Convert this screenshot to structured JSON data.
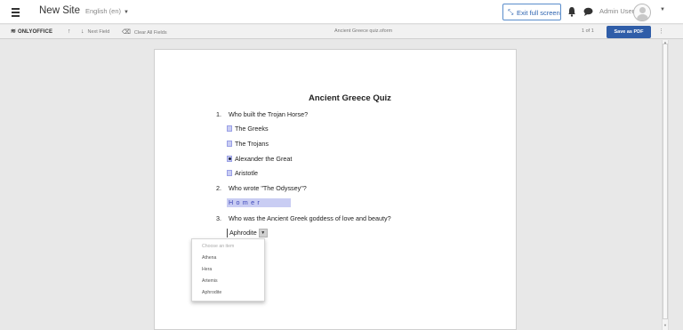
{
  "topbar": {
    "site_name": "New Site",
    "language": "English (en)",
    "exit_fullscreen_label": "Exit full screen",
    "user_name": "Admin User"
  },
  "toolbar": {
    "logo_text": "ONLYOFFICE",
    "next_field_label": "Next Field",
    "clear_fields_label": "Clear All Fields",
    "document_name": "Ancient Greece quiz.oform",
    "page_count": "1 of 1",
    "save_pdf_label": "Save as PDF"
  },
  "document": {
    "title": "Ancient Greece Quiz",
    "questions": [
      {
        "number": "1.",
        "text": "Who built the Trojan Horse?",
        "options": [
          {
            "label": "The Greeks",
            "checked": false
          },
          {
            "label": "The Trojans",
            "checked": false
          },
          {
            "label": "Alexander the Great",
            "checked": true
          },
          {
            "label": "Aristotle",
            "checked": false
          }
        ]
      },
      {
        "number": "2.",
        "text": "Who wrote \"The Odyssey\"?",
        "answer": "Homer"
      },
      {
        "number": "3.",
        "text": "Who was the Ancient Greek goddess of love and beauty?",
        "selected": "Aphrodite",
        "dropdown": {
          "placeholder": "Choose an item",
          "items": [
            "Athena",
            "Hera",
            "Artemis",
            "Aphrodite"
          ]
        }
      }
    ]
  },
  "colors": {
    "field_highlight": "#c9cdf3",
    "accent": "#2f5da8",
    "exit_button": "#2e64b0"
  }
}
